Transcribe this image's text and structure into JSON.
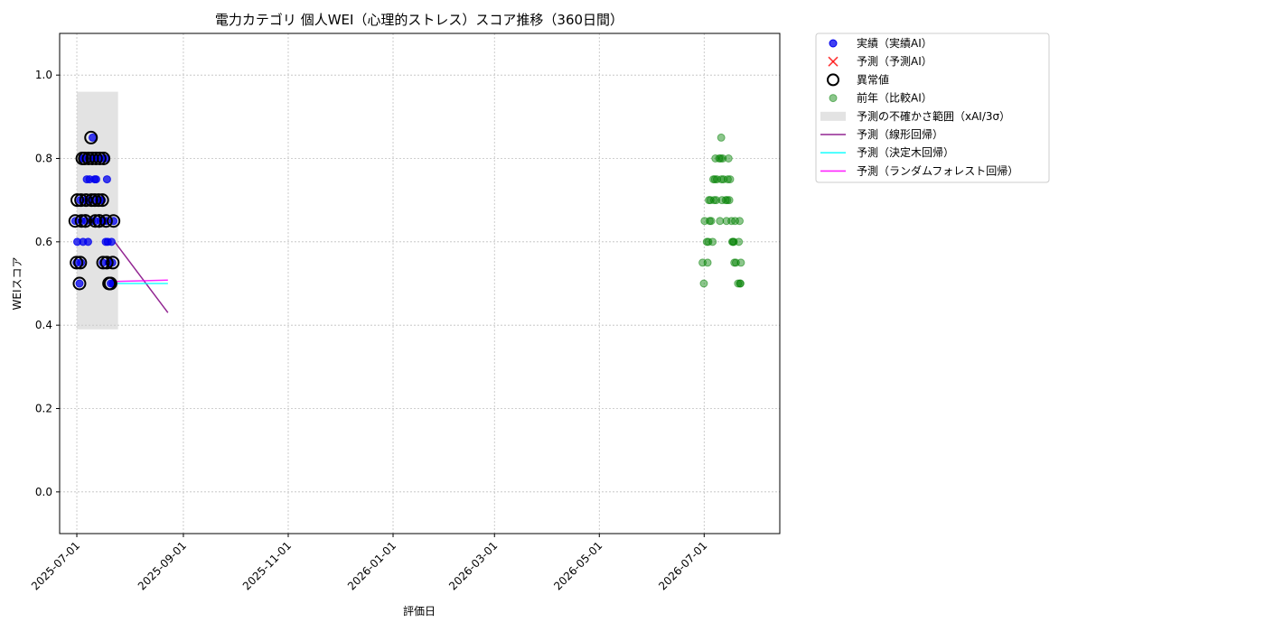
{
  "chart_data": {
    "type": "scatter",
    "title": "電力カテゴリ 個人WEI（心理的ストレス）スコア推移（360日間）",
    "xlabel": "評価日",
    "ylabel": "WEIスコア",
    "x_ticks": [
      "2025-07-01",
      "2025-09-01",
      "2025-11-01",
      "2026-01-01",
      "2026-03-01",
      "2026-05-01",
      "2026-07-01"
    ],
    "xlim": [
      "2025-06-21",
      "2026-08-14"
    ],
    "ylim": [
      -0.1,
      1.1
    ],
    "y_ticks": [
      "0.0",
      "0.2",
      "0.4",
      "0.6",
      "0.8",
      "1.0"
    ],
    "grid": true,
    "legend_placement": "outside-top-right",
    "colors": {
      "actual": "#0000ee",
      "predicted": "#ff0000",
      "anomaly": "#000000",
      "prev_year": "#008000",
      "band": "#cccccc",
      "linear": "#800080",
      "tree": "#00ffff",
      "forest": "#ff00ff"
    },
    "legend": [
      {
        "key": "actual",
        "label": "実績（実績AI）",
        "marker": "dot"
      },
      {
        "key": "predicted",
        "label": "予測（予測AI）",
        "marker": "x"
      },
      {
        "key": "anomaly",
        "label": "異常値",
        "marker": "ring"
      },
      {
        "key": "prev_year",
        "label": "前年（比較AI）",
        "marker": "dot-faint"
      },
      {
        "key": "band",
        "label": "予測の不確かさ範囲（xAI/3σ）",
        "marker": "patch"
      },
      {
        "key": "linear",
        "label": "予測（線形回帰）",
        "marker": "line"
      },
      {
        "key": "tree",
        "label": "予測（決定木回帰）",
        "marker": "line"
      },
      {
        "key": "forest",
        "label": "予測（ランダムフォレスト回帰）",
        "marker": "line"
      }
    ],
    "series": {
      "actual": [
        [
          "2025-07-01",
          0.65
        ],
        [
          "2025-07-01",
          0.55
        ],
        [
          "2025-07-02",
          0.5
        ],
        [
          "2025-07-02",
          0.6
        ],
        [
          "2025-07-03",
          0.7
        ],
        [
          "2025-07-03",
          0.65
        ],
        [
          "2025-07-04",
          0.55
        ],
        [
          "2025-07-04",
          0.8
        ],
        [
          "2025-07-05",
          0.7
        ],
        [
          "2025-07-05",
          0.6
        ],
        [
          "2025-07-06",
          0.65
        ],
        [
          "2025-07-06",
          0.8
        ],
        [
          "2025-07-07",
          0.75
        ],
        [
          "2025-07-07",
          0.6
        ],
        [
          "2025-07-08",
          0.7
        ],
        [
          "2025-07-08",
          0.8
        ],
        [
          "2025-07-09",
          0.65
        ],
        [
          "2025-07-09",
          0.75
        ],
        [
          "2025-07-10",
          0.85
        ],
        [
          "2025-07-10",
          0.8
        ],
        [
          "2025-07-11",
          0.7
        ],
        [
          "2025-07-11",
          0.75
        ],
        [
          "2025-07-12",
          0.8
        ],
        [
          "2025-07-12",
          0.65
        ],
        [
          "2025-07-13",
          0.7
        ],
        [
          "2025-07-13",
          0.75
        ],
        [
          "2025-07-14",
          0.8
        ],
        [
          "2025-07-14",
          0.65
        ],
        [
          "2025-07-15",
          0.7
        ],
        [
          "2025-07-15",
          0.8
        ],
        [
          "2025-07-16",
          0.65
        ],
        [
          "2025-07-16",
          0.7
        ],
        [
          "2025-07-17",
          0.8
        ],
        [
          "2025-07-17",
          0.55
        ],
        [
          "2025-07-18",
          0.6
        ],
        [
          "2025-07-18",
          0.75
        ],
        [
          "2025-07-19",
          0.65
        ],
        [
          "2025-07-19",
          0.6
        ],
        [
          "2025-07-20",
          0.5
        ],
        [
          "2025-07-20",
          0.55
        ],
        [
          "2025-07-21",
          0.6
        ],
        [
          "2025-07-21",
          0.5
        ],
        [
          "2025-07-22",
          0.55
        ],
        [
          "2025-07-22",
          0.65
        ],
        [
          "2025-07-23",
          0.5
        ]
      ],
      "anomaly": [
        [
          "2025-07-01",
          0.65
        ],
        [
          "2025-07-01",
          0.55
        ],
        [
          "2025-07-02",
          0.5
        ],
        [
          "2025-07-02",
          0.7
        ],
        [
          "2025-07-03",
          0.55
        ],
        [
          "2025-07-03",
          0.65
        ],
        [
          "2025-07-04",
          0.7
        ],
        [
          "2025-07-04",
          0.8
        ],
        [
          "2025-07-05",
          0.65
        ],
        [
          "2025-07-06",
          0.8
        ],
        [
          "2025-07-06",
          0.7
        ],
        [
          "2025-07-07",
          0.65
        ],
        [
          "2025-07-08",
          0.8
        ],
        [
          "2025-07-09",
          0.7
        ],
        [
          "2025-07-10",
          0.85
        ],
        [
          "2025-07-10",
          0.8
        ],
        [
          "2025-07-11",
          0.65
        ],
        [
          "2025-07-12",
          0.7
        ],
        [
          "2025-07-12",
          0.8
        ],
        [
          "2025-07-13",
          0.65
        ],
        [
          "2025-07-14",
          0.7
        ],
        [
          "2025-07-14",
          0.8
        ],
        [
          "2025-07-15",
          0.65
        ],
        [
          "2025-07-16",
          0.7
        ],
        [
          "2025-07-16",
          0.8
        ],
        [
          "2025-07-17",
          0.55
        ],
        [
          "2025-07-18",
          0.65
        ],
        [
          "2025-07-19",
          0.5
        ],
        [
          "2025-07-19",
          0.55
        ],
        [
          "2025-07-20",
          0.5
        ],
        [
          "2025-07-21",
          0.55
        ],
        [
          "2025-07-21",
          0.5
        ],
        [
          "2025-07-22",
          0.65
        ]
      ],
      "band": {
        "x_start": "2025-07-01",
        "x_end": "2025-07-25",
        "y_low": 0.39,
        "y_high": 0.96
      },
      "linear": [
        [
          "2025-07-23",
          0.6
        ],
        [
          "2025-08-23",
          0.43
        ]
      ],
      "tree": [
        [
          "2025-07-23",
          0.5
        ],
        [
          "2025-08-23",
          0.5
        ]
      ],
      "forest": [
        [
          "2025-07-23",
          0.505
        ],
        [
          "2025-08-23",
          0.508
        ]
      ],
      "prev_year": [
        [
          "2026-07-01",
          0.55
        ],
        [
          "2026-07-01",
          0.5
        ],
        [
          "2026-07-02",
          0.6
        ],
        [
          "2026-07-02",
          0.65
        ],
        [
          "2026-07-03",
          0.55
        ],
        [
          "2026-07-03",
          0.7
        ],
        [
          "2026-07-04",
          0.6
        ],
        [
          "2026-07-04",
          0.65
        ],
        [
          "2026-07-05",
          0.6
        ],
        [
          "2026-07-05",
          0.7
        ],
        [
          "2026-07-06",
          0.75
        ],
        [
          "2026-07-06",
          0.65
        ],
        [
          "2026-07-07",
          0.7
        ],
        [
          "2026-07-07",
          0.8
        ],
        [
          "2026-07-08",
          0.75
        ],
        [
          "2026-07-08",
          0.7
        ],
        [
          "2026-07-09",
          0.8
        ],
        [
          "2026-07-09",
          0.75
        ],
        [
          "2026-07-10",
          0.65
        ],
        [
          "2026-07-10",
          0.85
        ],
        [
          "2026-07-11",
          0.8
        ],
        [
          "2026-07-11",
          0.7
        ],
        [
          "2026-07-12",
          0.75
        ],
        [
          "2026-07-12",
          0.8
        ],
        [
          "2026-07-13",
          0.7
        ],
        [
          "2026-07-13",
          0.75
        ],
        [
          "2026-07-14",
          0.65
        ],
        [
          "2026-07-14",
          0.75
        ],
        [
          "2026-07-15",
          0.7
        ],
        [
          "2026-07-15",
          0.8
        ],
        [
          "2026-07-16",
          0.65
        ],
        [
          "2026-07-16",
          0.7
        ],
        [
          "2026-07-17",
          0.6
        ],
        [
          "2026-07-17",
          0.75
        ],
        [
          "2026-07-18",
          0.6
        ],
        [
          "2026-07-18",
          0.55
        ],
        [
          "2026-07-19",
          0.6
        ],
        [
          "2026-07-19",
          0.65
        ],
        [
          "2026-07-20",
          0.5
        ],
        [
          "2026-07-20",
          0.55
        ],
        [
          "2026-07-21",
          0.6
        ],
        [
          "2026-07-21",
          0.5
        ],
        [
          "2026-07-22",
          0.65
        ],
        [
          "2026-07-22",
          0.55
        ],
        [
          "2026-07-23",
          0.5
        ]
      ]
    }
  }
}
